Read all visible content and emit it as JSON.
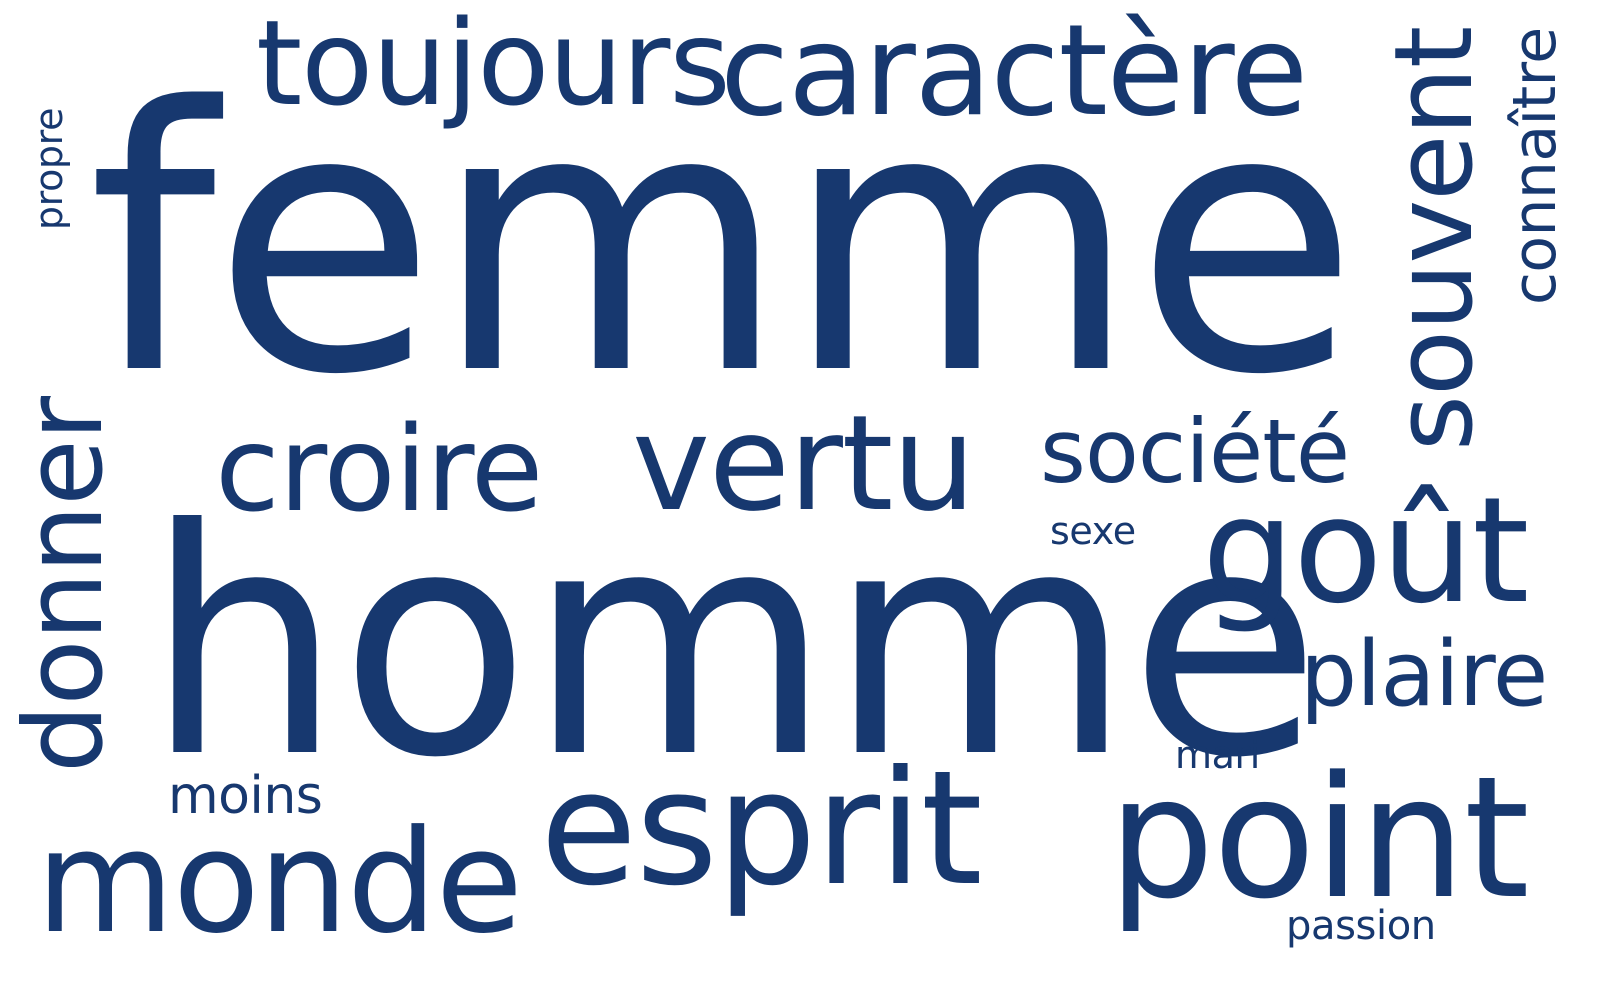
{
  "theme": {
    "word_color": "#17386f",
    "background": "#ffffff"
  },
  "words": {
    "femme": "femme",
    "homme": "homme",
    "toujours": "toujours",
    "caractere": "caractère",
    "souvent": "souvent",
    "connaitre": "connaître",
    "propre": "propre",
    "donner": "donner",
    "croire": "croire",
    "vertu": "vertu",
    "societe": "société",
    "sexe": "sexe",
    "gout": "goût",
    "plaire": "plaire",
    "mari": "mari",
    "moins": "moins",
    "monde": "monde",
    "esprit": "esprit",
    "point": "point",
    "passion": "passion"
  }
}
